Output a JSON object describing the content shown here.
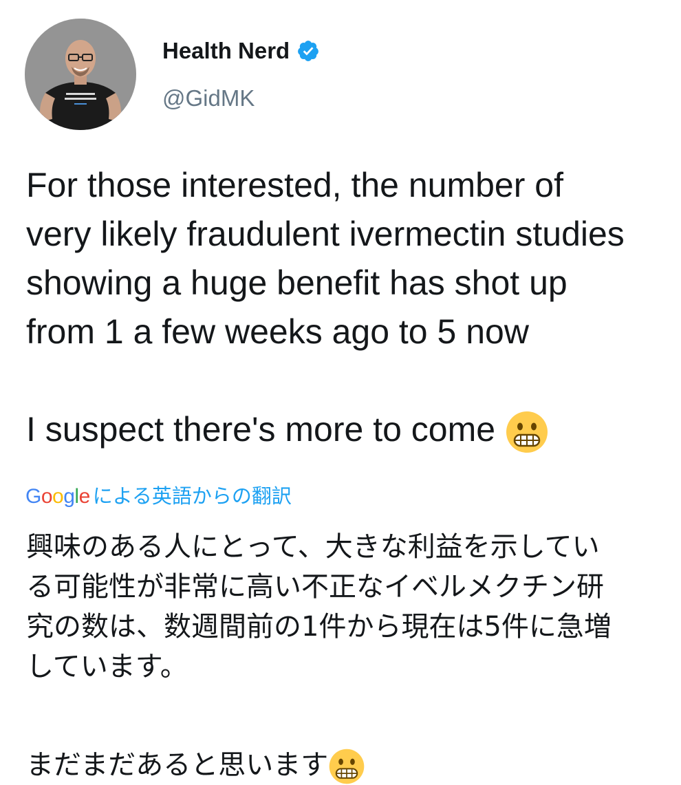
{
  "author": {
    "display_name": "Health Nerd",
    "handle": "@GidMK",
    "avatar_shirt_text": "TRUST ME, I'M AN EPIDEMIOLOGIST",
    "verified_badge_color": "#1da1f2"
  },
  "tweet": {
    "lines": [
      "For those interested, the number of",
      "very likely fraudulent ivermectin studies",
      "showing a huge benefit has shot up",
      "from 1 a few weeks ago to 5 now"
    ],
    "closing_line": "I suspect there's more to come",
    "closing_emoji": "grimacing-face"
  },
  "translation": {
    "logo_letters": [
      "G",
      "o",
      "o",
      "g",
      "l",
      "e"
    ],
    "label": "による英語からの翻訳",
    "lines": [
      "興味のある人にとって、大きな利益を示してい",
      "る可能性が非常に高い不正なイベルメクチン研",
      "究の数は、数週間前の1件から現在は5件に急増",
      "しています。"
    ],
    "closing_line": "まだまだあると思います",
    "link_color": "#1da1f2"
  }
}
